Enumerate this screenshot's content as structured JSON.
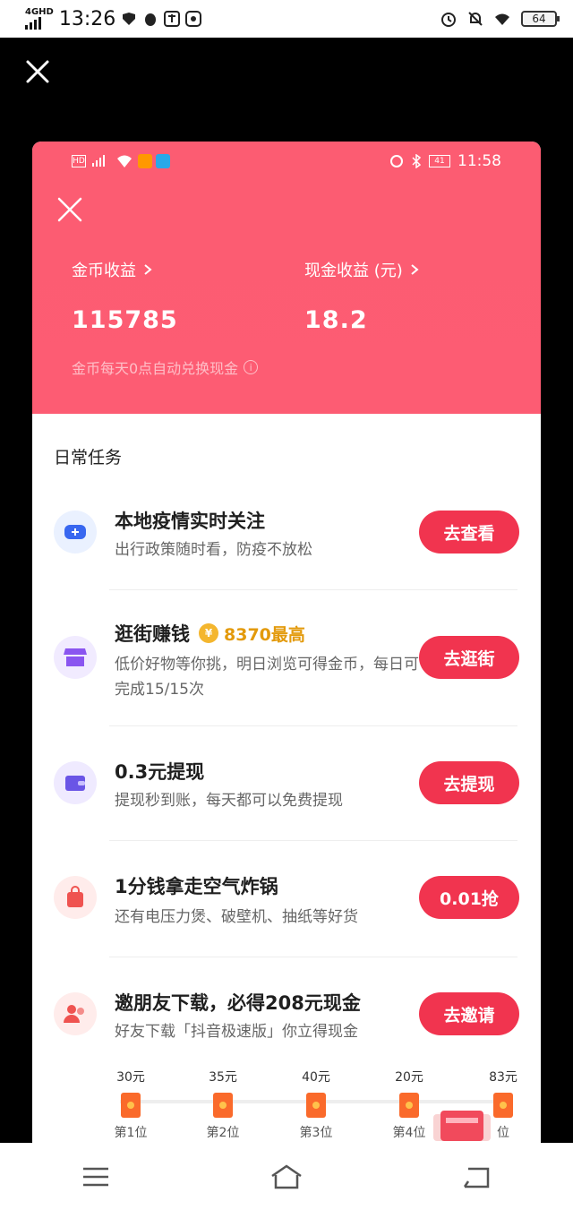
{
  "outer_status": {
    "network": "4GHD",
    "time": "13:26",
    "battery": "64"
  },
  "inner_status": {
    "time": "11:58",
    "battery": "41"
  },
  "hero": {
    "coins_label": "金币收益",
    "coins_value": "115785",
    "cash_label": "现金收益 (元)",
    "cash_value": "18.2",
    "note": "金币每天0点自动兑换现金"
  },
  "section_title": "日常任务",
  "tasks": [
    {
      "title": "本地疫情实时关注",
      "desc": "出行政策随时看，防疫不放松",
      "button": "去查看",
      "icon": "mask-icon"
    },
    {
      "title": "逛街赚钱",
      "bonus": "8370最高",
      "desc": "低价好物等你挑，明日浏览可得金币，每日可完成15/15次",
      "button": "去逛街",
      "icon": "shop-icon"
    },
    {
      "title": "0.3元提现",
      "desc": "提现秒到账，每天都可以免费提现",
      "button": "去提现",
      "icon": "wallet-icon"
    },
    {
      "title": "1分钱拿走空气炸锅",
      "desc": "还有电压力煲、破壁机、抽纸等好货",
      "button": "0.01抢",
      "icon": "bag-icon"
    },
    {
      "title": "邀朋友下载，必得208元现金",
      "desc": "好友下载「抖音极速版」你立得现金",
      "button": "去邀请",
      "icon": "friends-icon"
    }
  ],
  "invite_progress": [
    {
      "amount": "30元",
      "rank": "第1位"
    },
    {
      "amount": "35元",
      "rank": "第2位"
    },
    {
      "amount": "40元",
      "rank": "第3位"
    },
    {
      "amount": "20元",
      "rank": "第4位"
    },
    {
      "amount": "83元",
      "rank": "位"
    }
  ],
  "colors": {
    "hero": "#fc5c72",
    "button": "#f1344f",
    "bonus": "#e39a0c"
  }
}
